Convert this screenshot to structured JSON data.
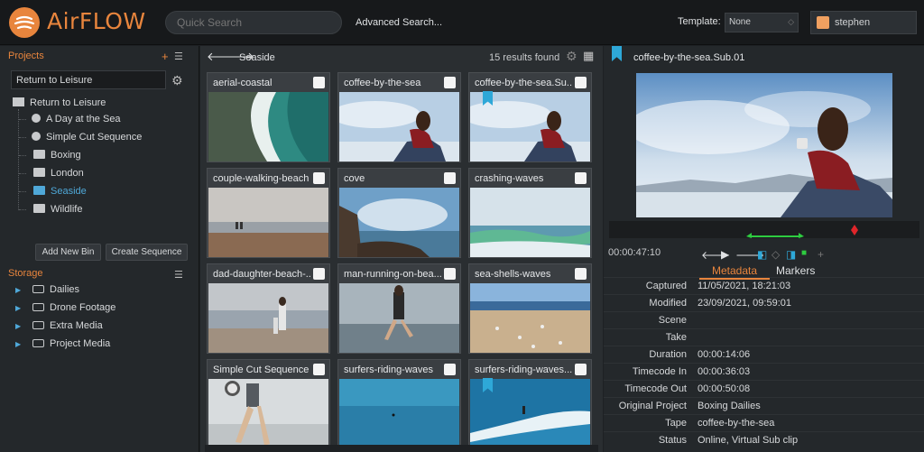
{
  "app": {
    "logo_text": "AirFLOW"
  },
  "header": {
    "search_placeholder": "Quick Search",
    "advanced_search": "Advanced Search...",
    "template_label": "Template:",
    "template_value": "None",
    "user_name": "stephen"
  },
  "projects": {
    "title": "Projects",
    "add_icon": "+",
    "current": "Return to Leisure",
    "tree": [
      {
        "label": "Return to Leisure",
        "icon": "project-icon"
      },
      {
        "label": "A Day at the Sea",
        "icon": "sequence-icon"
      },
      {
        "label": "Simple Cut Sequence",
        "icon": "sequence-icon"
      },
      {
        "label": "Boxing",
        "icon": "folder-icon"
      },
      {
        "label": "London",
        "icon": "folder-icon"
      },
      {
        "label": "Seaside",
        "icon": "folder-icon",
        "selected": true
      },
      {
        "label": "Wildlife",
        "icon": "folder-icon"
      }
    ],
    "add_bin": "Add New Bin",
    "create_sequence": "Create Sequence"
  },
  "storage": {
    "title": "Storage",
    "items": [
      "Dailies",
      "Drone Footage",
      "Extra Media",
      "Project Media"
    ]
  },
  "center": {
    "breadcrumb": "Seaside",
    "results": "15 results found",
    "tiles": [
      {
        "title": "aerial-coastal",
        "thumb": "aerial"
      },
      {
        "title": "coffee-by-the-sea",
        "thumb": "coffee"
      },
      {
        "title": "coffee-by-the-sea.Su...",
        "thumb": "coffee",
        "bookmark": true
      },
      {
        "title": "couple-walking-beach",
        "thumb": "beach"
      },
      {
        "title": "cove",
        "thumb": "cove"
      },
      {
        "title": "crashing-waves",
        "thumb": "waves"
      },
      {
        "title": "dad-daughter-beach-...",
        "thumb": "family"
      },
      {
        "title": "man-running-on-bea...",
        "thumb": "runner"
      },
      {
        "title": "sea-shells-waves",
        "thumb": "shells"
      },
      {
        "title": "Simple Cut Sequence",
        "thumb": "jogger",
        "reel": true
      },
      {
        "title": "surfers-riding-waves",
        "thumb": "ocean"
      },
      {
        "title": "surfers-riding-waves....",
        "thumb": "surf",
        "bookmark": true
      }
    ]
  },
  "viewer": {
    "title": "coffee-by-the-sea.Sub.01",
    "timecode": "00:00:47:10",
    "tabs": [
      "Metadata",
      "Markers"
    ],
    "metadata": [
      {
        "key": "Captured",
        "value": "11/05/2021, 18:21:03"
      },
      {
        "key": "Modified",
        "value": "23/09/2021, 09:59:01"
      },
      {
        "key": "Scene",
        "value": ""
      },
      {
        "key": "Take",
        "value": ""
      },
      {
        "key": "Duration",
        "value": "00:00:14:06"
      },
      {
        "key": "Timecode In",
        "value": "00:00:36:03"
      },
      {
        "key": "Timecode Out",
        "value": "00:00:50:08"
      },
      {
        "key": "Original Project",
        "value": "Boxing Dailies"
      },
      {
        "key": "Tape",
        "value": "coffee-by-the-sea"
      },
      {
        "key": "Status",
        "value": "Online, Virtual Sub clip"
      }
    ]
  },
  "colors": {
    "accent": "#e8853d",
    "selection": "#4fa8d8",
    "bookmark": "#2ea8d8"
  }
}
